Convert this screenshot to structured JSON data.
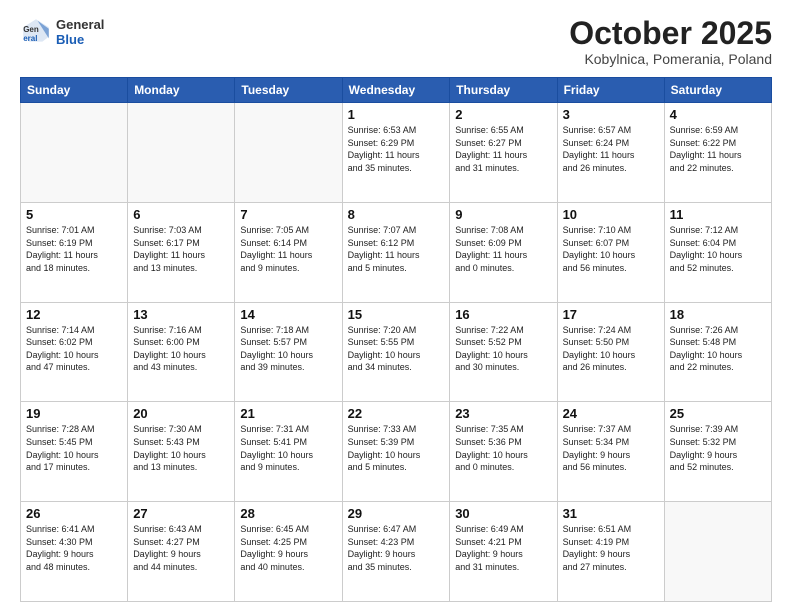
{
  "header": {
    "logo_line1": "General",
    "logo_line2": "Blue",
    "title": "October 2025",
    "subtitle": "Kobylnica, Pomerania, Poland"
  },
  "weekdays": [
    "Sunday",
    "Monday",
    "Tuesday",
    "Wednesday",
    "Thursday",
    "Friday",
    "Saturday"
  ],
  "weeks": [
    [
      {
        "day": "",
        "info": ""
      },
      {
        "day": "",
        "info": ""
      },
      {
        "day": "",
        "info": ""
      },
      {
        "day": "1",
        "info": "Sunrise: 6:53 AM\nSunset: 6:29 PM\nDaylight: 11 hours\nand 35 minutes."
      },
      {
        "day": "2",
        "info": "Sunrise: 6:55 AM\nSunset: 6:27 PM\nDaylight: 11 hours\nand 31 minutes."
      },
      {
        "day": "3",
        "info": "Sunrise: 6:57 AM\nSunset: 6:24 PM\nDaylight: 11 hours\nand 26 minutes."
      },
      {
        "day": "4",
        "info": "Sunrise: 6:59 AM\nSunset: 6:22 PM\nDaylight: 11 hours\nand 22 minutes."
      }
    ],
    [
      {
        "day": "5",
        "info": "Sunrise: 7:01 AM\nSunset: 6:19 PM\nDaylight: 11 hours\nand 18 minutes."
      },
      {
        "day": "6",
        "info": "Sunrise: 7:03 AM\nSunset: 6:17 PM\nDaylight: 11 hours\nand 13 minutes."
      },
      {
        "day": "7",
        "info": "Sunrise: 7:05 AM\nSunset: 6:14 PM\nDaylight: 11 hours\nand 9 minutes."
      },
      {
        "day": "8",
        "info": "Sunrise: 7:07 AM\nSunset: 6:12 PM\nDaylight: 11 hours\nand 5 minutes."
      },
      {
        "day": "9",
        "info": "Sunrise: 7:08 AM\nSunset: 6:09 PM\nDaylight: 11 hours\nand 0 minutes."
      },
      {
        "day": "10",
        "info": "Sunrise: 7:10 AM\nSunset: 6:07 PM\nDaylight: 10 hours\nand 56 minutes."
      },
      {
        "day": "11",
        "info": "Sunrise: 7:12 AM\nSunset: 6:04 PM\nDaylight: 10 hours\nand 52 minutes."
      }
    ],
    [
      {
        "day": "12",
        "info": "Sunrise: 7:14 AM\nSunset: 6:02 PM\nDaylight: 10 hours\nand 47 minutes."
      },
      {
        "day": "13",
        "info": "Sunrise: 7:16 AM\nSunset: 6:00 PM\nDaylight: 10 hours\nand 43 minutes."
      },
      {
        "day": "14",
        "info": "Sunrise: 7:18 AM\nSunset: 5:57 PM\nDaylight: 10 hours\nand 39 minutes."
      },
      {
        "day": "15",
        "info": "Sunrise: 7:20 AM\nSunset: 5:55 PM\nDaylight: 10 hours\nand 34 minutes."
      },
      {
        "day": "16",
        "info": "Sunrise: 7:22 AM\nSunset: 5:52 PM\nDaylight: 10 hours\nand 30 minutes."
      },
      {
        "day": "17",
        "info": "Sunrise: 7:24 AM\nSunset: 5:50 PM\nDaylight: 10 hours\nand 26 minutes."
      },
      {
        "day": "18",
        "info": "Sunrise: 7:26 AM\nSunset: 5:48 PM\nDaylight: 10 hours\nand 22 minutes."
      }
    ],
    [
      {
        "day": "19",
        "info": "Sunrise: 7:28 AM\nSunset: 5:45 PM\nDaylight: 10 hours\nand 17 minutes."
      },
      {
        "day": "20",
        "info": "Sunrise: 7:30 AM\nSunset: 5:43 PM\nDaylight: 10 hours\nand 13 minutes."
      },
      {
        "day": "21",
        "info": "Sunrise: 7:31 AM\nSunset: 5:41 PM\nDaylight: 10 hours\nand 9 minutes."
      },
      {
        "day": "22",
        "info": "Sunrise: 7:33 AM\nSunset: 5:39 PM\nDaylight: 10 hours\nand 5 minutes."
      },
      {
        "day": "23",
        "info": "Sunrise: 7:35 AM\nSunset: 5:36 PM\nDaylight: 10 hours\nand 0 minutes."
      },
      {
        "day": "24",
        "info": "Sunrise: 7:37 AM\nSunset: 5:34 PM\nDaylight: 9 hours\nand 56 minutes."
      },
      {
        "day": "25",
        "info": "Sunrise: 7:39 AM\nSunset: 5:32 PM\nDaylight: 9 hours\nand 52 minutes."
      }
    ],
    [
      {
        "day": "26",
        "info": "Sunrise: 6:41 AM\nSunset: 4:30 PM\nDaylight: 9 hours\nand 48 minutes."
      },
      {
        "day": "27",
        "info": "Sunrise: 6:43 AM\nSunset: 4:27 PM\nDaylight: 9 hours\nand 44 minutes."
      },
      {
        "day": "28",
        "info": "Sunrise: 6:45 AM\nSunset: 4:25 PM\nDaylight: 9 hours\nand 40 minutes."
      },
      {
        "day": "29",
        "info": "Sunrise: 6:47 AM\nSunset: 4:23 PM\nDaylight: 9 hours\nand 35 minutes."
      },
      {
        "day": "30",
        "info": "Sunrise: 6:49 AM\nSunset: 4:21 PM\nDaylight: 9 hours\nand 31 minutes."
      },
      {
        "day": "31",
        "info": "Sunrise: 6:51 AM\nSunset: 4:19 PM\nDaylight: 9 hours\nand 27 minutes."
      },
      {
        "day": "",
        "info": ""
      }
    ]
  ]
}
